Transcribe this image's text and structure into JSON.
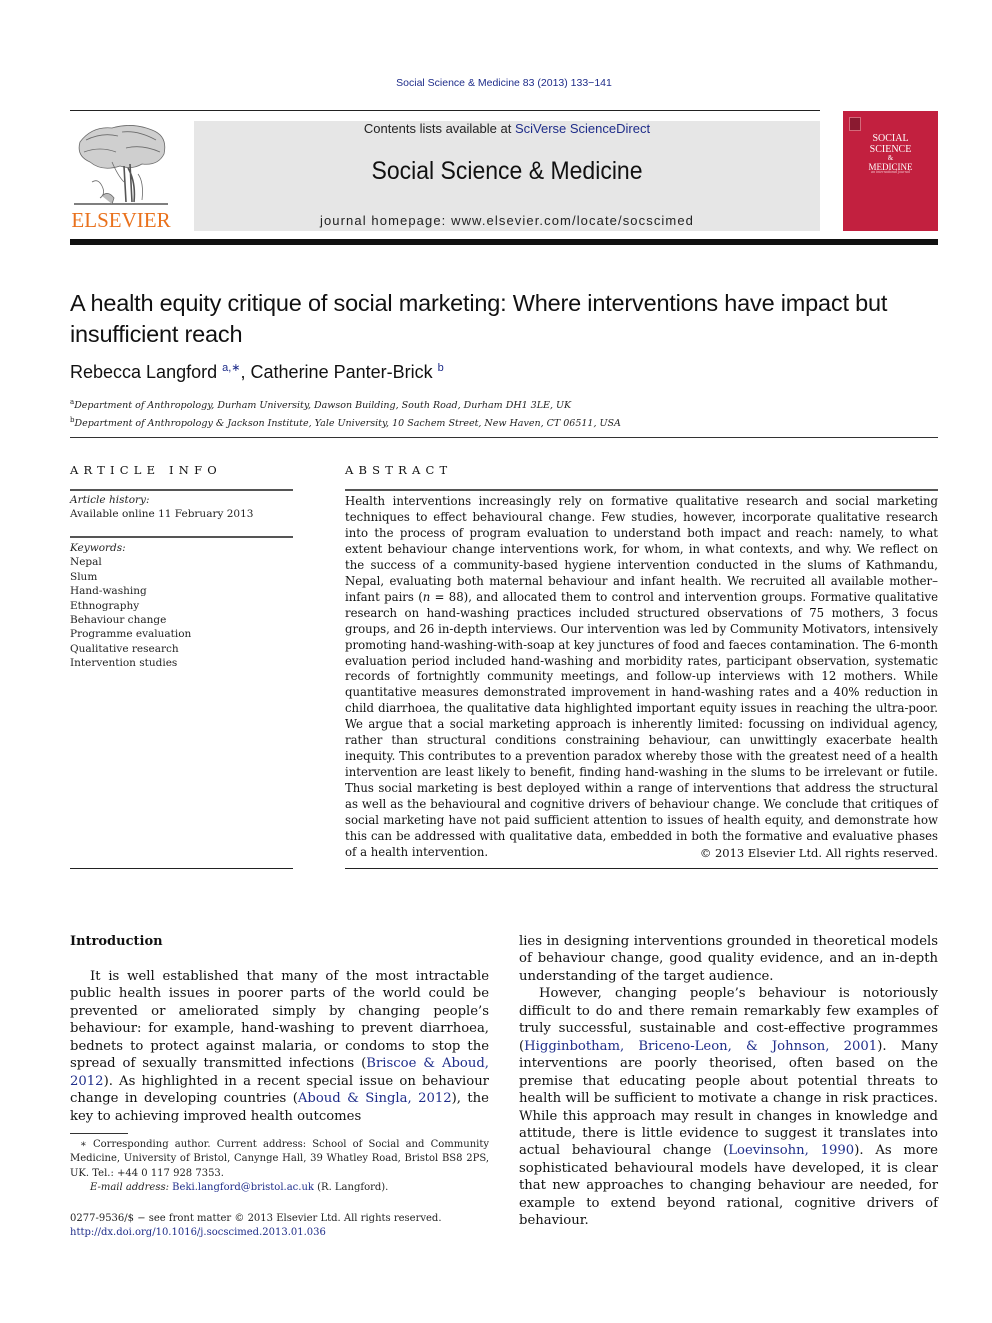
{
  "header": {
    "journal_reference": "Social Science & Medicine 83 (2013) 133−141",
    "publisher_wordmark": "ELSEVIER",
    "contents_prefix": "Contents lists available at ",
    "contents_link": "SciVerse ScienceDirect",
    "journal_title": "Social Science & Medicine",
    "homepage_prefix": "journal homepage: ",
    "homepage_url": "www.elsevier.com/locate/socscimed",
    "cover": {
      "title_lines": [
        "SOCIAL",
        "SCIENCE",
        "&",
        "MEDICINE"
      ],
      "subtitle": "an international journal",
      "color": "#c2203f"
    },
    "brand_color": "#e9711c",
    "link_color": "#1f2d8a"
  },
  "article": {
    "title": "A health equity critique of social marketing: Where interventions have impact but insufficient reach",
    "authors": [
      {
        "name": "Rebecca Langford",
        "marks": "a,∗"
      },
      {
        "name": "Catherine Panter-Brick",
        "marks": "b"
      }
    ],
    "author_separator": ", ",
    "affiliations": [
      {
        "mark": "a",
        "text": "Department of Anthropology, Durham University, Dawson Building, South Road, Durham DH1 3LE, UK"
      },
      {
        "mark": "b",
        "text": "Department of Anthropology & Jackson Institute, Yale University, 10 Sachem Street, New Haven, CT 06511, USA"
      }
    ]
  },
  "article_info": {
    "heading": "ARTICLE INFO",
    "history_label": "Article history:",
    "history_value": "Available online 11 February 2013",
    "keywords_label": "Keywords:",
    "keywords": [
      "Nepal",
      "Slum",
      "Hand-washing",
      "Ethnography",
      "Behaviour change",
      "Programme evaluation",
      "Qualitative research",
      "Intervention studies"
    ]
  },
  "abstract": {
    "heading": "ABSTRACT",
    "text_before_n": "Health interventions increasingly rely on formative qualitative research and social marketing techniques to effect behavioural change. Few studies, however, incorporate qualitative research into the process of program evaluation to understand both impact and reach: namely, to what extent behaviour change interventions work, for whom, in what contexts, and why. We reflect on the success of a community-based hygiene intervention conducted in the slums of Kathmandu, Nepal, evaluating both maternal behaviour and infant health. We recruited all available mother–infant pairs (",
    "n_symbol": "n",
    "text_after_n": " = 88), and allocated them to control and intervention groups. Formative qualitative research on hand-washing practices included structured observations of 75 mothers, 3 focus groups, and 26 in-depth interviews. Our intervention was led by Community Motivators, intensively promoting hand-washing-with-soap at key junctures of food and faeces contamination. The 6-month evaluation period included hand-washing and morbidity rates, participant observation, systematic records of fortnightly community meetings, and follow-up interviews with 12 mothers. While quantitative measures demonstrated improvement in hand-washing rates and a 40% reduction in child diarrhoea, the qualitative data highlighted important equity issues in reaching the ultra-poor. We argue that a social marketing approach is inherently limited: focussing on individual agency, rather than structural conditions constraining behaviour, can unwittingly exacerbate health inequity. This contributes to a prevention paradox whereby those with the greatest need of a health intervention are least likely to benefit, finding hand-washing in the slums to be irrelevant or futile. Thus social marketing is best deployed within a range of interventions that address the structural as well as the behavioural and cognitive drivers of behaviour change. We conclude that critiques of social marketing have not paid sufficient attention to issues of health equity, and demonstrate how this can be addressed with qualitative data, embedded in both the formative and evaluative phases of a health intervention.",
    "copyright": "© 2013 Elsevier Ltd. All rights reserved."
  },
  "body": {
    "intro_heading": "Introduction",
    "left_para": {
      "t1": "It is well established that many of the most intractable public health issues in poorer parts of the world could be prevented or ameliorated simply by changing people’s behaviour: for example, hand-washing to prevent diarrhoea, bednets to protect against malaria, or condoms to stop the spread of sexually transmitted infections (",
      "c1": "Briscoe & Aboud, 2012",
      "t2": "). As highlighted in a recent special issue on behaviour change in developing countries (",
      "c2": "Aboud & Singla, 2012",
      "t3": "), the key to achieving improved health outcomes"
    },
    "right_para1": "lies in designing interventions grounded in theoretical models of behaviour change, good quality evidence, and an in-depth understanding of the target audience.",
    "right_para2": {
      "t1": "However, changing people’s behaviour is notoriously difficult to do and there remain remarkably few examples of truly successful, sustainable and cost-effective programmes (",
      "c1": "Higginbotham, Briceno-Leon, & Johnson, 2001",
      "t2": "). Many interventions are poorly theorised, often based on the premise that educating people about potential threats to health will be sufficient to motivate a change in risk practices. While this approach may result in changes in knowledge and attitude, there is little evidence to suggest it translates into actual behavioural change (",
      "c2": "Loevinsohn, 1990",
      "t3": "). As more sophisticated behavioural models have developed, it is clear that new approaches to changing behaviour are needed, for example to extend beyond rational, cognitive drivers of behaviour."
    }
  },
  "footnote": {
    "mark": "∗",
    "text": " Corresponding author. Current address: School of Social and Community Medicine, University of Bristol, Canynge Hall, 39 Whatley Road, Bristol BS8 2PS, UK. Tel.: +44 0 117 928 7353.",
    "email_label": "E-mail address:",
    "email": "Beki.langford@bristol.ac.uk",
    "email_owner": " (R. Langford)."
  },
  "front_matter": {
    "issn_line": "0277-9536/$ − see front matter © 2013 Elsevier Ltd. All rights reserved.",
    "doi": "http://dx.doi.org/10.1016/j.socscimed.2013.01.036"
  }
}
